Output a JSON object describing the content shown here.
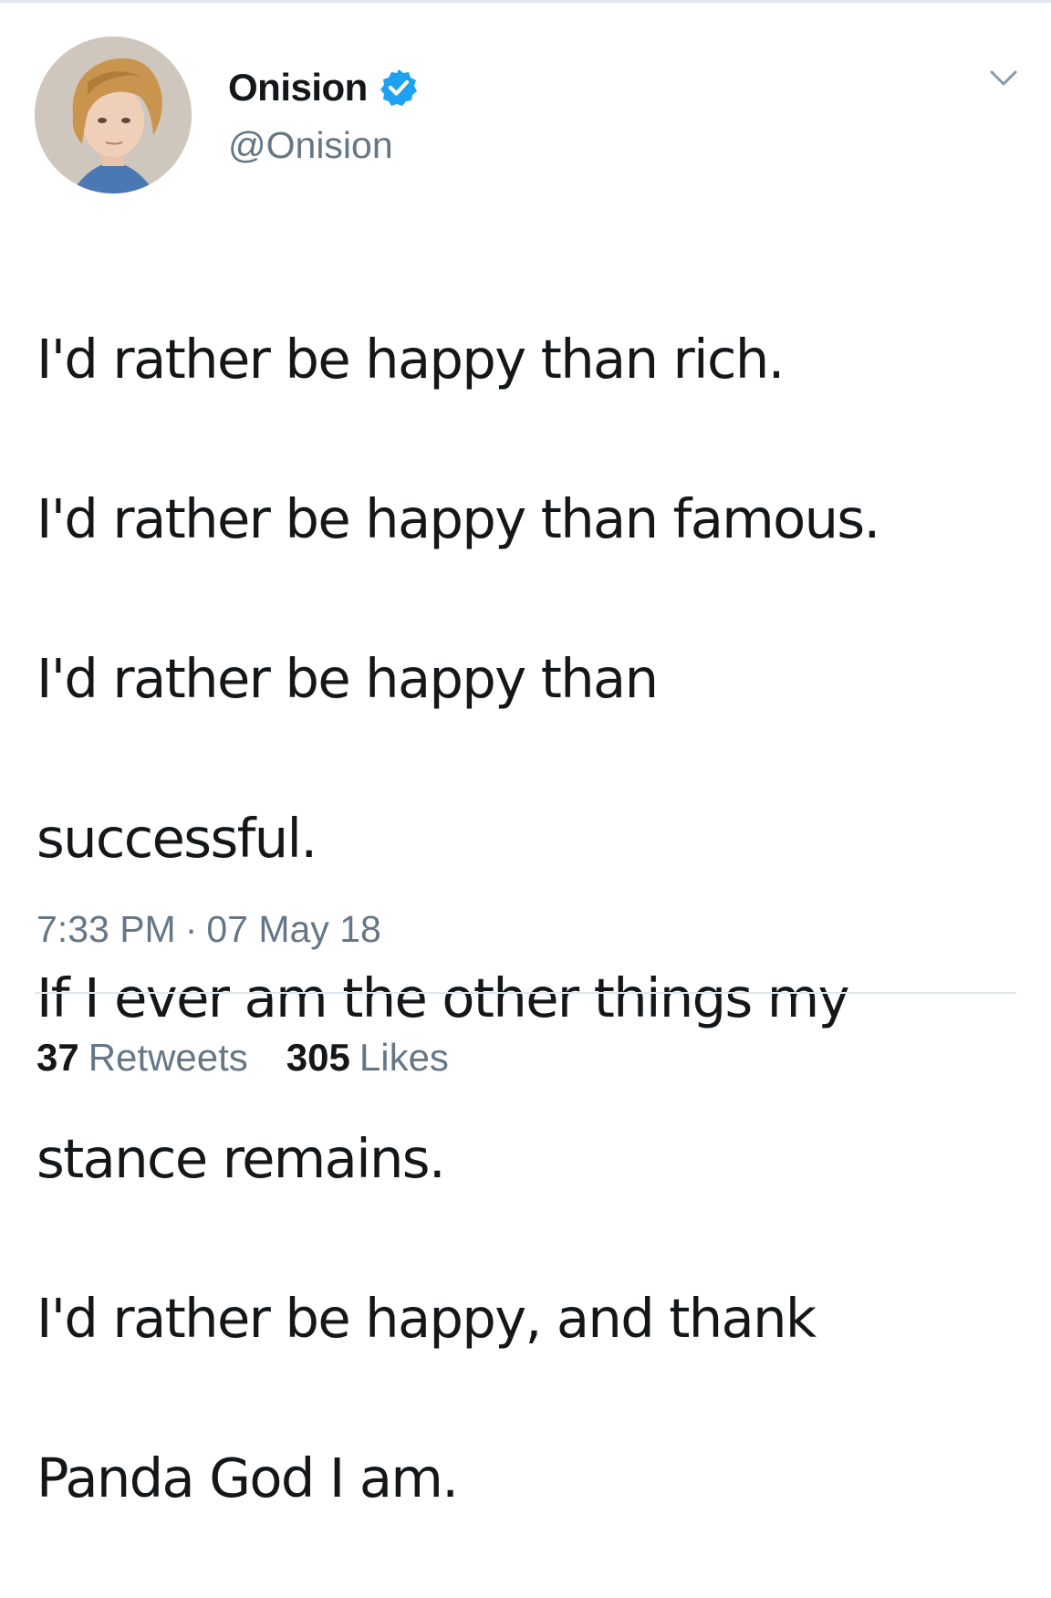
{
  "colors": {
    "text": "#14171a",
    "muted": "#657786",
    "verified": "#1da1f2",
    "divider": "#e1e8ed"
  },
  "author": {
    "display_name": "Onision",
    "handle": "@Onision",
    "verified": true,
    "avatar_icon": "profile-photo",
    "menu_icon": "chevron-down-icon"
  },
  "tweet": {
    "lines": [
      "I'd rather be happy than rich.",
      "I'd rather be happy than famous.",
      "I'd rather be happy than",
      "successful.",
      "If I ever am the other things my",
      "stance remains.",
      "I'd rather be happy, and thank",
      "Panda God I am."
    ],
    "time": "7:33 PM",
    "separator": "·",
    "date": "07 May 18"
  },
  "stats": {
    "retweets_count": "37",
    "retweets_label": "Retweets",
    "likes_count": "305",
    "likes_label": "Likes"
  }
}
